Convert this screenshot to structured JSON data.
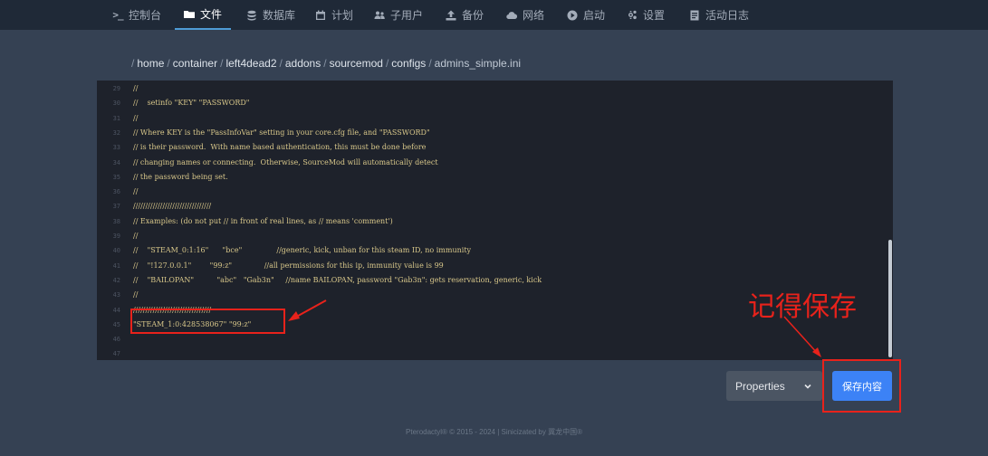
{
  "nav": {
    "items": [
      {
        "label": "控制台",
        "icon": "terminal-icon"
      },
      {
        "label": "文件",
        "icon": "folder-icon",
        "active": true
      },
      {
        "label": "数据库",
        "icon": "database-icon"
      },
      {
        "label": "计划",
        "icon": "calendar-icon"
      },
      {
        "label": "子用户",
        "icon": "users-icon"
      },
      {
        "label": "备份",
        "icon": "upload-icon"
      },
      {
        "label": "网络",
        "icon": "cloud-icon"
      },
      {
        "label": "启动",
        "icon": "play-circle-icon"
      },
      {
        "label": "设置",
        "icon": "cogs-icon"
      },
      {
        "label": "活动日志",
        "icon": "file-icon"
      }
    ],
    "terminal_glyph": ">_"
  },
  "breadcrumb": {
    "separator": "/",
    "segments": [
      "home",
      "container",
      "left4dead2",
      "addons",
      "sourcemod",
      "configs"
    ],
    "file": "admins_simple.ini"
  },
  "editor": {
    "lines": [
      {
        "num": "29",
        "text": "//"
      },
      {
        "num": "30",
        "text": "//    setinfo \"KEY\" \"PASSWORD\""
      },
      {
        "num": "31",
        "text": "//"
      },
      {
        "num": "32",
        "text": "// Where KEY is the \"PassInfoVar\" setting in your core.cfg file, and \"PASSWORD\""
      },
      {
        "num": "33",
        "text": "// is their password.  With name based authentication, this must be done before"
      },
      {
        "num": "34",
        "text": "// changing names or connecting.  Otherwise, SourceMod will automatically detect"
      },
      {
        "num": "35",
        "text": "// the password being set."
      },
      {
        "num": "36",
        "text": "//"
      },
      {
        "num": "37",
        "text": "////////////////////////////////"
      },
      {
        "num": "38",
        "text": "// Examples: (do not put // in front of real lines, as // means 'comment')"
      },
      {
        "num": "39",
        "text": "//"
      },
      {
        "num": "40",
        "text": "//    \"STEAM_0:1:16\"      \"bce\"               //generic, kick, unban for this steam ID, no immunity"
      },
      {
        "num": "41",
        "text": "//    \"!127.0.0.1\"        \"99:z\"              //all permissions for this ip, immunity value is 99"
      },
      {
        "num": "42",
        "text": "//    \"BAILOPAN\"          \"abc\"   \"Gab3n\"     //name BAILOPAN, password \"Gab3n\": gets reservation, generic, kick"
      },
      {
        "num": "43",
        "text": "//"
      },
      {
        "num": "44",
        "text": "////////////////////////////////"
      },
      {
        "num": "45",
        "text": "\"STEAM_1:0:428538067\" \"99:z\""
      },
      {
        "num": "46",
        "text": ""
      },
      {
        "num": "47",
        "text": ""
      }
    ]
  },
  "annotation": {
    "label": "记得保存",
    "color": "#e8221b"
  },
  "language_select": {
    "value": "Properties"
  },
  "save_button": {
    "label": "保存内容"
  },
  "footer": {
    "text": "Pterodactyl® © 2015 - 2024 | Sinicizated by 冀龙中国®"
  },
  "colors": {
    "accent": "#3c82f6",
    "nav_active_underline": "#4e9bd5",
    "code_text": "#d8c78a"
  }
}
